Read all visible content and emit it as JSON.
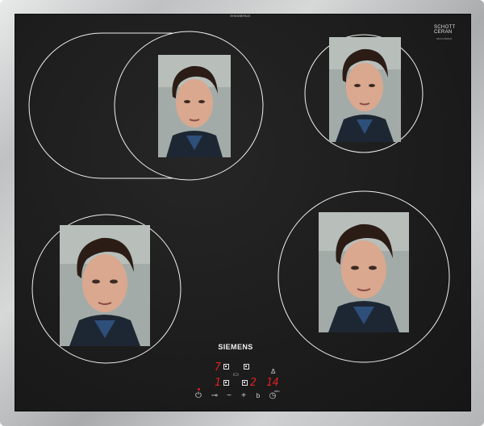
{
  "cooktop": {
    "model_text": "EH645BFB1E",
    "glass_brand_line1": "SCHOTT",
    "glass_brand_line2": "CERAN",
    "glass_brand_sub": "REGISTERED",
    "brand": "SIEMENS"
  },
  "controls": {
    "display_left_top": "7",
    "display_left_bottom": "1",
    "display_right_a": "2",
    "display_right_b": "14",
    "min_label": "min",
    "power_symbol": "⏻",
    "minus_symbol": "−",
    "plus_symbol": "+",
    "b_label": "b",
    "clock_symbol": "◷",
    "bell_symbol": "Δ"
  },
  "zones": [
    {
      "name": "rear-left-dual-zone"
    },
    {
      "name": "rear-right-zone"
    },
    {
      "name": "front-left-zone"
    },
    {
      "name": "front-right-zone"
    }
  ],
  "colors": {
    "glass": "#1c1c1c",
    "frame": "#c4c6c7",
    "zone_lines": "#f0f0f0",
    "display_red": "#e02020"
  }
}
